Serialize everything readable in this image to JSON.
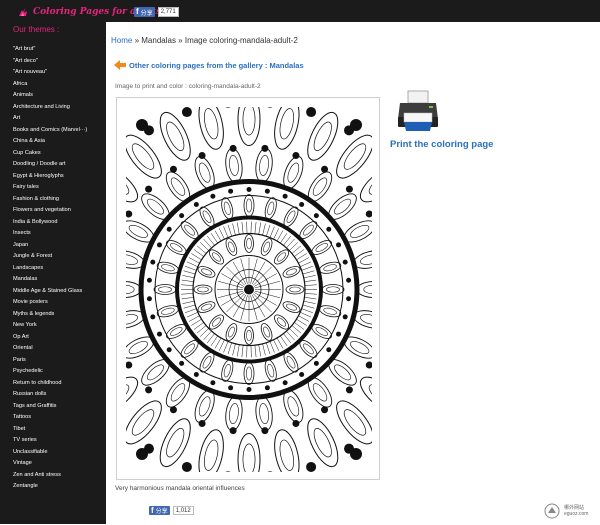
{
  "site": {
    "title": "Coloring Pages for adults",
    "fb_share_label": "分享",
    "fb_share_count": "2,771"
  },
  "sidebar": {
    "title": "Our themes :",
    "items": [
      "\"Art brut\"",
      "\"Art deco\"",
      "\"Art nouveau\"",
      "Africa",
      "Animals",
      "Architecture and Living",
      "Art",
      "Books and Comics (Marvel···)",
      "China & Asia",
      "Cup Cakes",
      "Doodling / Doodle art",
      "Egypt & Hieroglyphs",
      "Fairy tales",
      "Fashion & clothing",
      "Flowers and vegetation",
      "India & Bollywood",
      "Insects",
      "Japan",
      "Jungle & Forest",
      "Landscapes",
      "Mandalas",
      "Middle Age & Stained Glass",
      "Movie posters",
      "Myths & legends",
      "New York",
      "Op Art",
      "Oriental",
      "Paris",
      "Psychedelic",
      "Return to childhood",
      "Russian dolls",
      "Tags and Graffitis",
      "Tattoos",
      "Tibet",
      "TV series",
      "Unclassifiable",
      "Vintage",
      "Zen and Anti stress",
      "Zentangle"
    ]
  },
  "main": {
    "breadcrumb": {
      "home": "Home",
      "sep1": " » ",
      "category": "Mandalas",
      "sep2": " » ",
      "current": "Image coloring-mandala-adult-2"
    },
    "gallery_link": "Other coloring pages from the gallery : Mandalas",
    "caption_top": "Image to print and color : coloring-mandala-adult-2",
    "print_label": "Print the coloring page",
    "caption_bottom": "Very harmonious mandala oriental influences",
    "fb_share_label": "分享",
    "fb_share_count": "1,012"
  },
  "watermark": {
    "line1": "哪外网站",
    "line2": "eguoz.com"
  },
  "colors": {
    "accent_pink": "#e6247b",
    "link_blue": "#2a70c0",
    "sidebar_bg": "#1b1b1b",
    "facebook_blue": "#4267b2"
  },
  "icons": [
    "brush-logo-icon",
    "facebook-icon",
    "orange-arrow-icon",
    "printer-icon"
  ]
}
